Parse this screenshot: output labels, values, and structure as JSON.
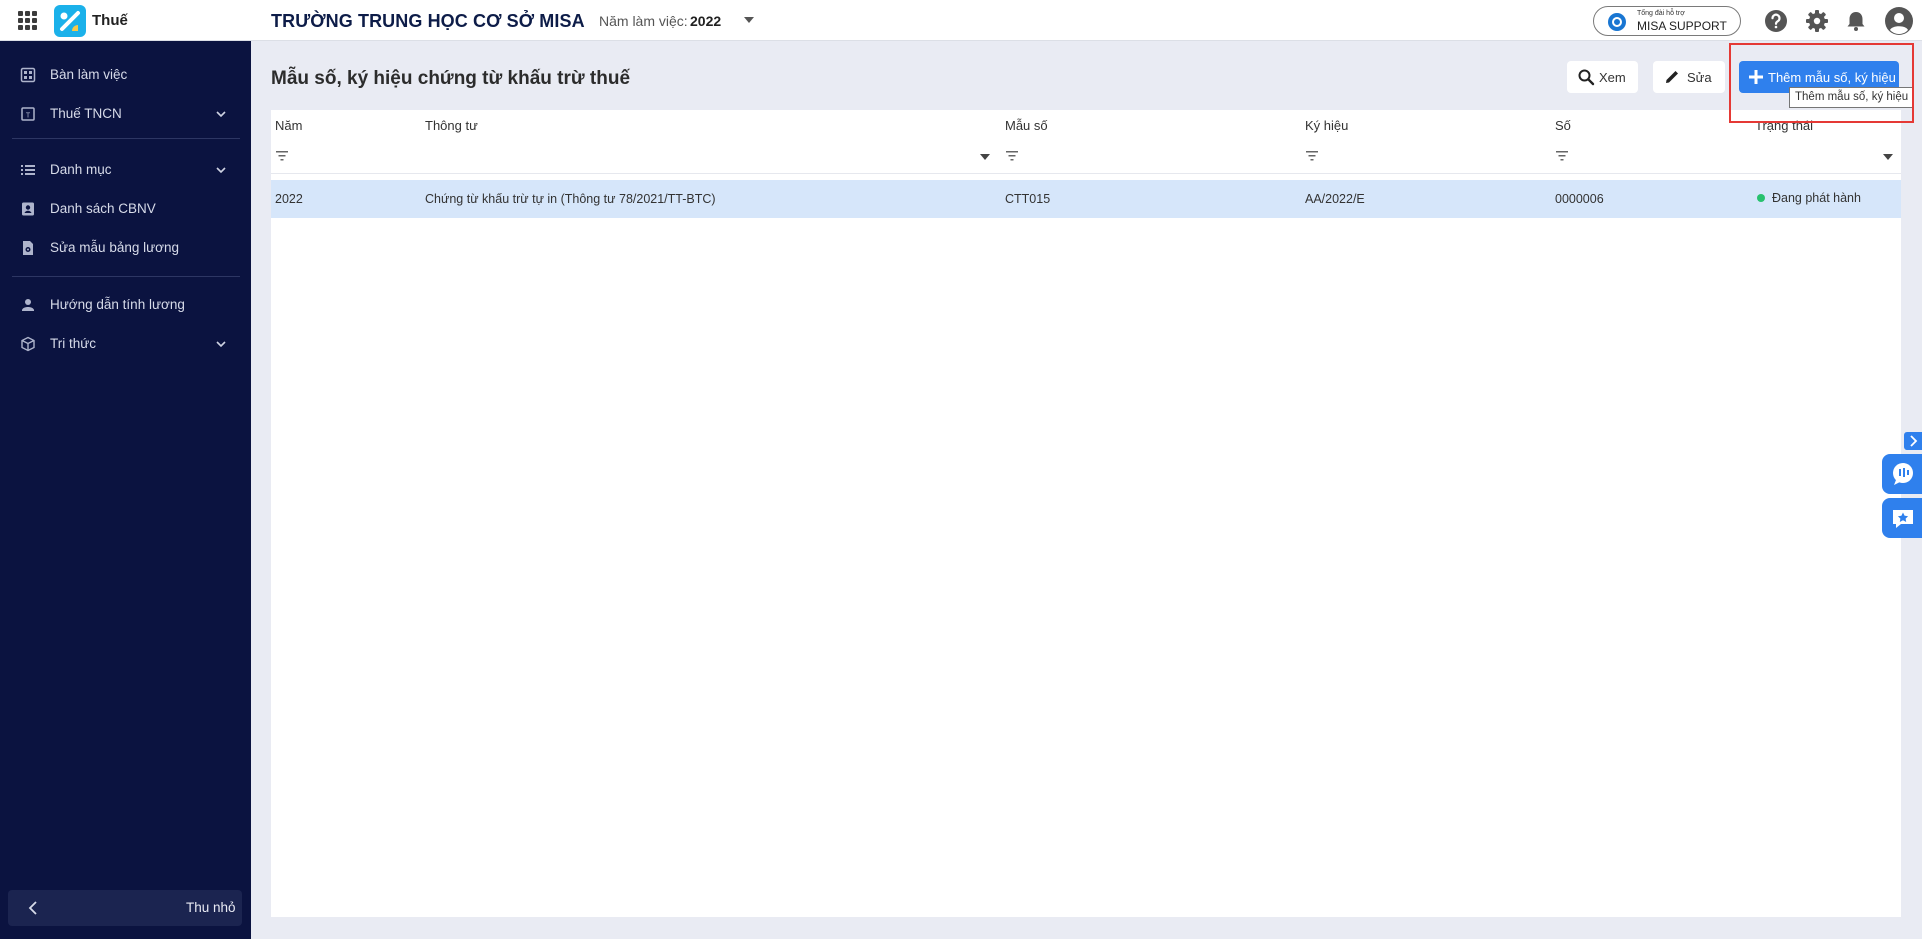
{
  "app": {
    "name": "Thuế",
    "org_name": "TRƯỜNG TRUNG HỌC CƠ SỞ MISA",
    "year_label": "Năm làm việc:",
    "year_value": "2022",
    "support_small": "Tổng đài hỗ trợ",
    "support_big": "MISA SUPPORT"
  },
  "sidebar": {
    "items": [
      {
        "label": "Bàn làm việc",
        "icon": "dashboard-icon"
      },
      {
        "label": "Thuế TNCN",
        "icon": "tax-icon"
      },
      {
        "label": "Danh mục",
        "icon": "list-icon"
      },
      {
        "label": "Danh sách CBNV",
        "icon": "contact-icon"
      },
      {
        "label": "Sửa mẫu bảng lương",
        "icon": "file-settings-icon"
      },
      {
        "label": "Hướng dẫn tính lương",
        "icon": "guide-icon"
      },
      {
        "label": "Tri thức",
        "icon": "cube-icon"
      }
    ],
    "collapse_label": "Thu nhỏ"
  },
  "main": {
    "title": "Mẫu số, ký hiệu chứng từ khấu trừ thuế",
    "view_label": "Xem",
    "edit_label": "Sửa",
    "add_label": "Thêm mẫu số, ký hiệu",
    "add_tooltip": "Thêm mẫu số, ký hiệu"
  },
  "table": {
    "columns": [
      "Năm",
      "Thông tư",
      "Mẫu số",
      "Ký hiệu",
      "Số",
      "Trạng thái"
    ],
    "rows": [
      {
        "year": "2022",
        "circular": "Chứng từ khấu trừ tự in (Thông tư 78/2021/TT-BTC)",
        "form": "CTT015",
        "symbol": "AA/2022/E",
        "number": "0000006",
        "status": "Đang phát hành",
        "status_color": "#27c16e"
      }
    ]
  },
  "colors": {
    "sidebar_bg": "#0b1340",
    "accent": "#2f80ed",
    "selected_row": "#d6e6fa",
    "highlight_box": "#e53935"
  }
}
